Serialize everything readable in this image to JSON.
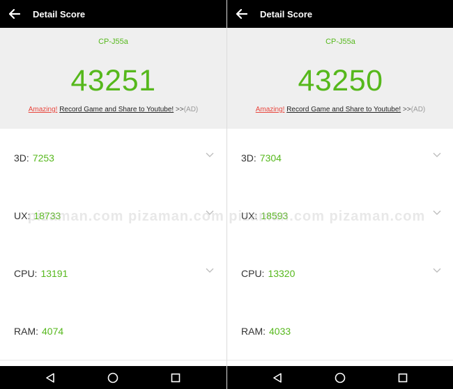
{
  "screens": [
    {
      "appbar": {
        "title": "Detail Score"
      },
      "device": "CP-J55a",
      "score": "43251",
      "promo": {
        "amazing": "Amazing!",
        "record": "Record Game and Share to Youtube!",
        "chevrons": ">>",
        "ad": "(AD)"
      },
      "rows": [
        {
          "label": "3D:",
          "value": "7253"
        },
        {
          "label": "UX:",
          "value": "18733"
        },
        {
          "label": "CPU:",
          "value": "13191"
        },
        {
          "label": "RAM:",
          "value": "4074"
        }
      ]
    },
    {
      "appbar": {
        "title": "Detail Score"
      },
      "device": "CP-J55a",
      "score": "43250",
      "promo": {
        "amazing": "Amazing!",
        "record": "Record Game and Share to Youtube!",
        "chevrons": ">>",
        "ad": "(AD)"
      },
      "rows": [
        {
          "label": "3D:",
          "value": "7304"
        },
        {
          "label": "UX:",
          "value": "18593"
        },
        {
          "label": "CPU:",
          "value": "13320"
        },
        {
          "label": "RAM:",
          "value": "4033"
        }
      ]
    }
  ],
  "watermark": "pizaman.com pizaman.com pizaman.com pizaman.com",
  "colors": {
    "accent": "#56b81c",
    "amazing": "#e8453c",
    "appbar": "#000000",
    "header_bg": "#efefef"
  },
  "icons": {
    "back": "arrow-left-icon",
    "expand": "chevron-down-icon",
    "nav_back": "triangle-back-icon",
    "nav_home": "circle-home-icon",
    "nav_recents": "square-recents-icon"
  }
}
